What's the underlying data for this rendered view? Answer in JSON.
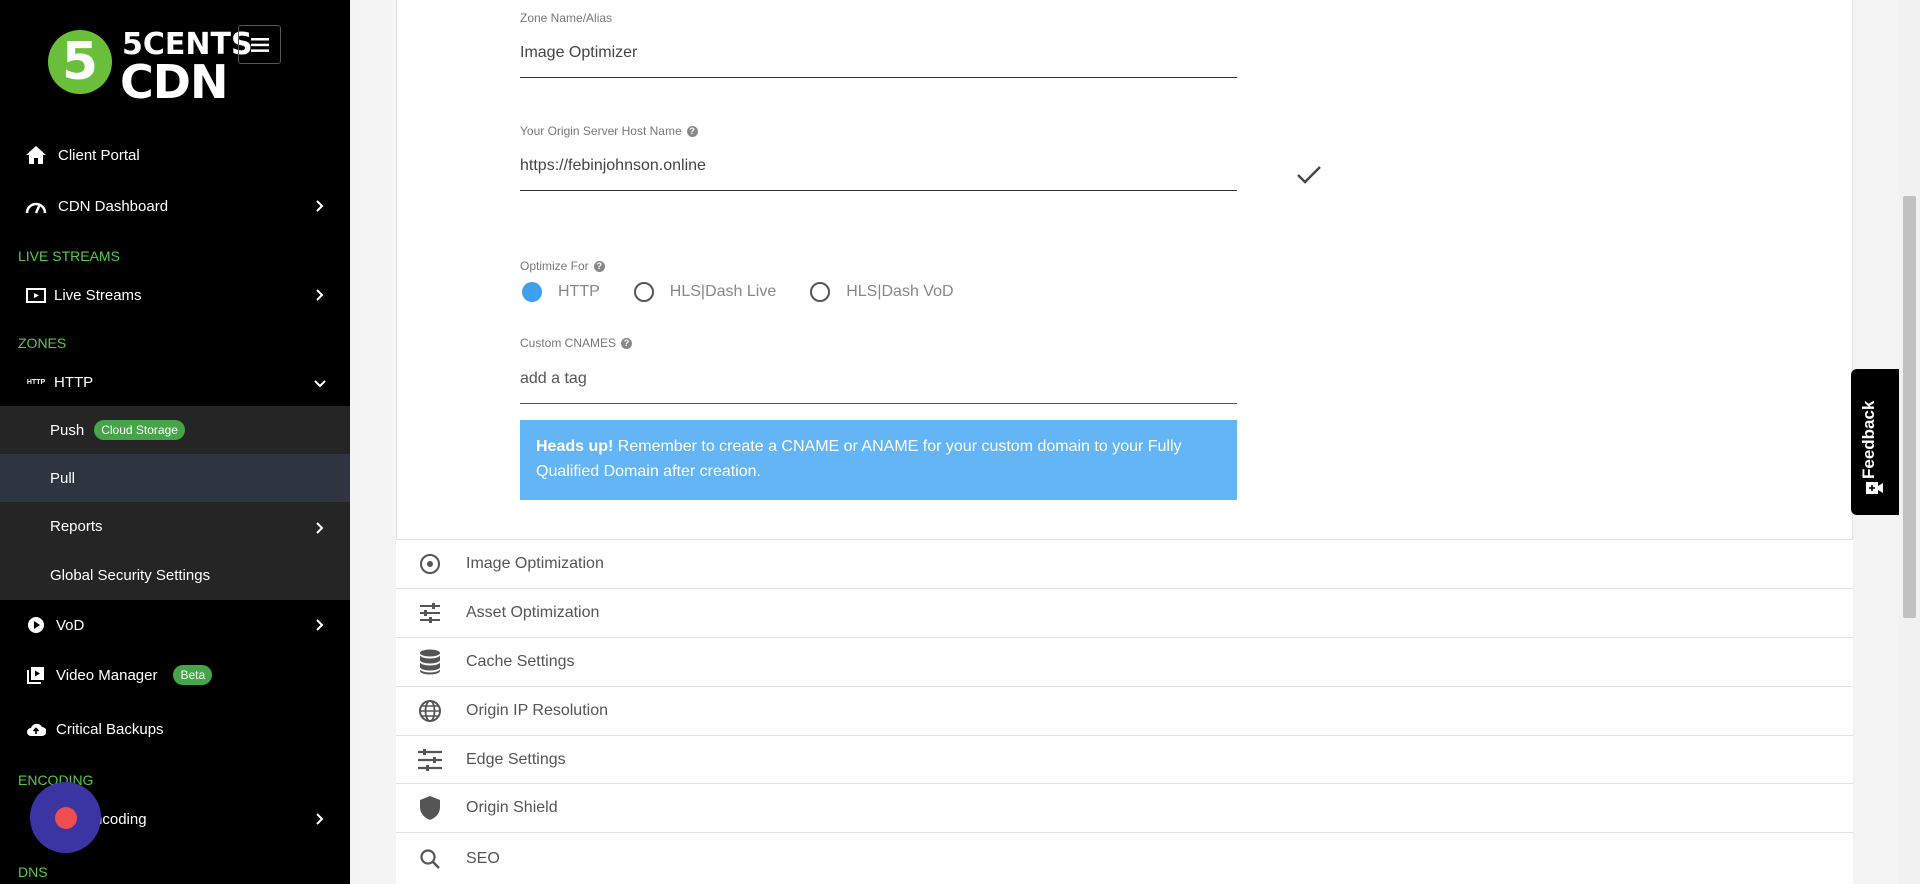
{
  "logo": {
    "line1": "5CENTS",
    "line2": "CDN",
    "digit": "5"
  },
  "nav": {
    "client_portal": "Client Portal",
    "cdn_dashboard": "CDN Dashboard",
    "live_streams_section": "LIVE STREAMS",
    "live_streams": "Live Streams",
    "zones_section": "ZONES",
    "http": "HTTP",
    "push": "Push",
    "push_badge": "Cloud Storage",
    "pull": "Pull",
    "reports": "Reports",
    "global_security": "Global Security Settings",
    "vod": "VoD",
    "video_manager": "Video Manager",
    "video_manager_badge": "Beta",
    "critical_backups": "Critical Backups",
    "encoding_section": "ENCODING",
    "encoding": "Encoding",
    "dns_section": "DNS"
  },
  "form": {
    "zone_name_label": "Zone Name/Alias",
    "zone_name_value": "Image Optimizer",
    "origin_label": "Your Origin Server Host Name",
    "origin_value": "https://febinjohnson.online",
    "optimize_label": "Optimize For",
    "optimize_options": [
      "HTTP",
      "HLS|Dash Live",
      "HLS|Dash VoD"
    ],
    "optimize_selected": "HTTP",
    "cnames_label": "Custom CNAMES",
    "cnames_placeholder": "add a tag",
    "alert_bold": "Heads up!",
    "alert_text": " Remember to create a CNAME or ANAME for your custom domain to your Fully Qualified Domain after creation."
  },
  "accordion": [
    {
      "label": "Image Optimization",
      "icon": "target-icon"
    },
    {
      "label": "Asset Optimization",
      "icon": "sliders-icon"
    },
    {
      "label": "Cache Settings",
      "icon": "database-icon"
    },
    {
      "label": "Origin IP Resolution",
      "icon": "globe-icon"
    },
    {
      "label": "Edge Settings",
      "icon": "tune-icon"
    },
    {
      "label": "Origin Shield",
      "icon": "shield-icon"
    },
    {
      "label": "SEO",
      "icon": "search-icon"
    }
  ],
  "feedback": {
    "label": "Feedback"
  },
  "colors": {
    "accent_green": "#57c94b",
    "alert_blue": "#64b5f6",
    "radio_blue": "#3ea0ee",
    "fab_purple": "#3b35a4"
  }
}
